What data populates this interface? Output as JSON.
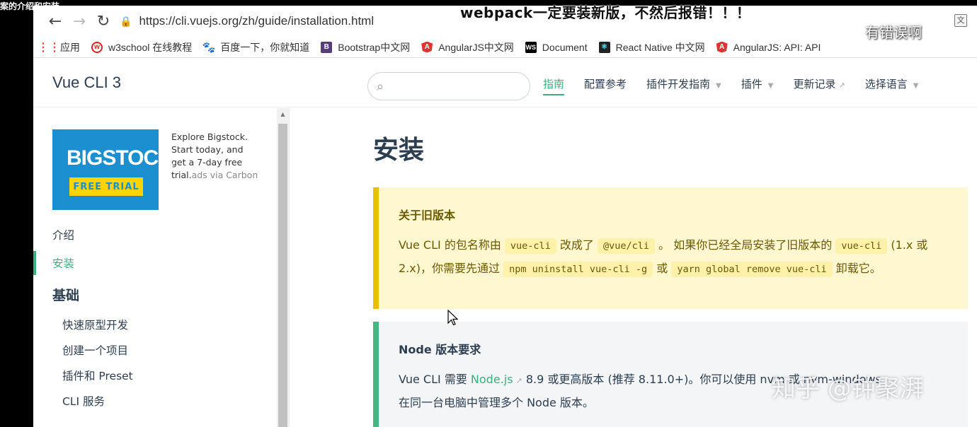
{
  "overlays": {
    "top_caption": "案的介绍和安装",
    "note": "webpack一定要装新版，不然后报错！！！",
    "error_label": "有错误啊",
    "watermark": "知乎 @钟聚湃"
  },
  "browser": {
    "url": "https://cli.vuejs.org/zh/guide/installation.html",
    "bookmarks": [
      {
        "label": "应用",
        "icon": "apps-icon"
      },
      {
        "label": "w3school 在线教程",
        "icon": "w3school-icon"
      },
      {
        "label": "百度一下，你就知道",
        "icon": "baidu-icon"
      },
      {
        "label": "Bootstrap中文网",
        "icon": "bootstrap-icon"
      },
      {
        "label": "AngularJS中文网",
        "icon": "angular-icon"
      },
      {
        "label": "Document",
        "icon": "ws-icon"
      },
      {
        "label": "React Native 中文网",
        "icon": "react-icon"
      },
      {
        "label": "AngularJS: API: API",
        "icon": "angular-icon"
      }
    ]
  },
  "site": {
    "logo": "Vue CLI 3",
    "nav": [
      {
        "label": "指南",
        "active": true
      },
      {
        "label": "配置参考"
      },
      {
        "label": "插件开发指南",
        "dropdown": true
      },
      {
        "label": "插件",
        "dropdown": true
      },
      {
        "label": "更新记录",
        "external": true
      },
      {
        "label": "选择语言",
        "dropdown": true
      }
    ]
  },
  "sidebar": {
    "ad": {
      "brand": "BIGSTOCK",
      "badge": "FREE TRIAL",
      "text": "Explore Bigstock. Start today, and get a 7-day free trial.",
      "via": "ads via Carbon"
    },
    "links": [
      "介绍",
      "安装"
    ],
    "group": "基础",
    "sub_links": [
      "快速原型开发",
      "创建一个项目",
      "插件和 Preset",
      "CLI 服务"
    ]
  },
  "content": {
    "title": "安装",
    "warning": {
      "title": "关于旧版本",
      "t1": "Vue CLI 的包名称由",
      "c1": "vue-cli",
      "t2": "改成了",
      "c2": "@vue/cli",
      "t3": "。 如果你已经全局安装了旧版本的",
      "c3": "vue-cli",
      "t4": "(1.x 或 2.x)，你需要先通过",
      "c4": "npm uninstall vue-cli -g",
      "t5": "或",
      "c5": "yarn global remove vue-cli",
      "t6": "卸载它。"
    },
    "tip": {
      "title": "Node 版本要求",
      "t1": "Vue CLI 需要",
      "link": "Node.js",
      "t2": "8.9 或更高版本 (推荐 8.11.0+)。你可以使用 nvm 或 nvm-windows",
      "t3": "在同一台电脑中管理多个 Node 版本。"
    }
  }
}
